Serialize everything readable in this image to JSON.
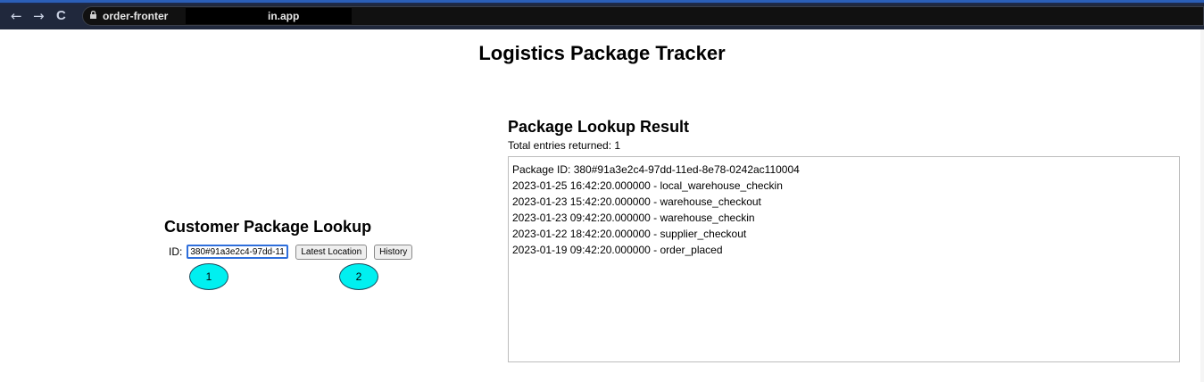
{
  "browser": {
    "url_prefix": "order-fronter",
    "url_suffix": "in.app",
    "back_glyph": "←",
    "forward_glyph": "→",
    "reload_glyph": "C",
    "colors": {
      "chrome": "#20283c",
      "accent": "#2b5fb8"
    }
  },
  "page": {
    "title": "Logistics Package Tracker"
  },
  "lookup": {
    "heading": "Customer Package Lookup",
    "id_label": "ID:",
    "id_value": "380#91a3e2c4-97dd-11ed-8e78-0242ac110004",
    "latest_location_label": "Latest Location",
    "history_label": "History",
    "markers": [
      "1",
      "2"
    ],
    "marker_color": "#00f0f0"
  },
  "result": {
    "heading": "Package Lookup Result",
    "count_text": "Total entries returned: 1",
    "lines": [
      "Package ID: 380#91a3e2c4-97dd-11ed-8e78-0242ac110004",
      "2023-01-25 16:42:20.000000 - local_warehouse_checkin",
      "2023-01-23 15:42:20.000000 - warehouse_checkout",
      "2023-01-23 09:42:20.000000 - warehouse_checkin",
      "2023-01-22 18:42:20.000000 - supplier_checkout",
      "2023-01-19 09:42:20.000000 - order_placed"
    ]
  }
}
